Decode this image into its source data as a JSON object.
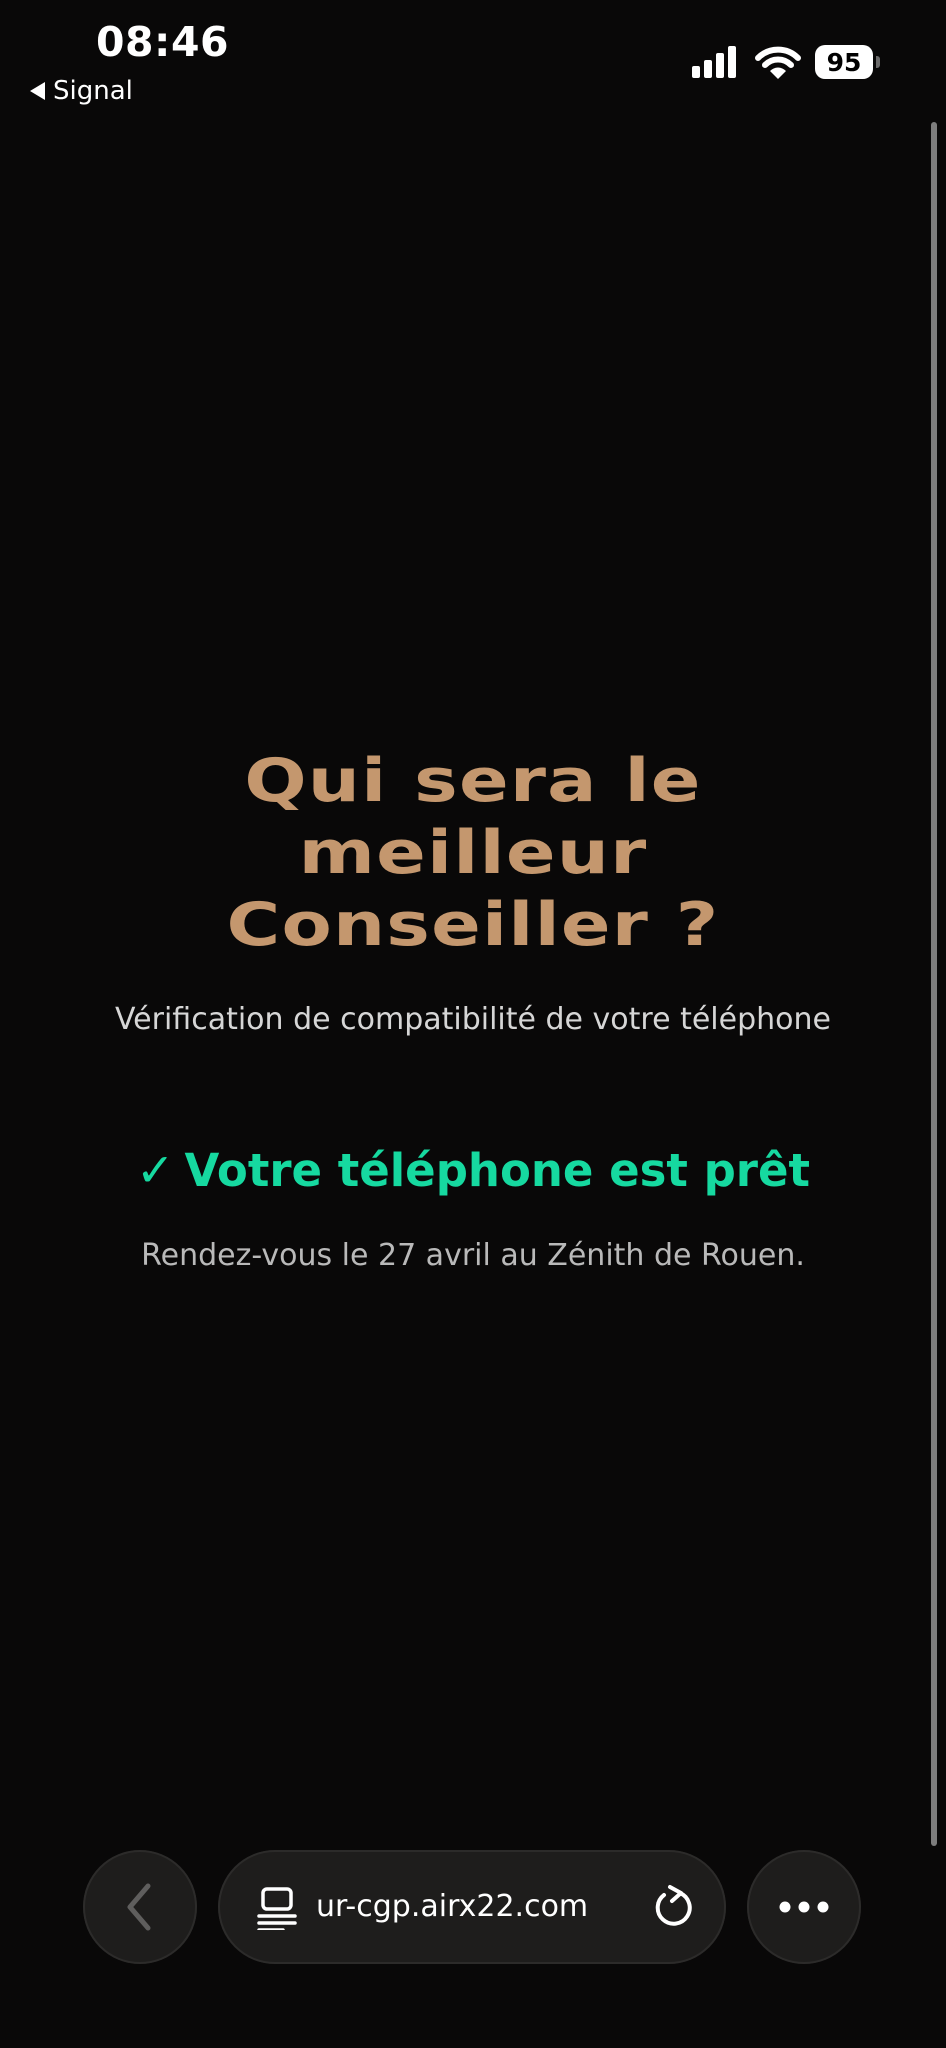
{
  "status_bar": {
    "time": "08:46",
    "back_app_label": "Signal",
    "battery_level": "95",
    "icons": [
      "cellular-signal-icon",
      "wifi-icon",
      "battery-icon"
    ]
  },
  "page": {
    "headline_lines": [
      "Qui sera le",
      "meilleur",
      "Conseiller ?"
    ],
    "subtitle": "Vérification de compatibilité de votre téléphone",
    "ready_check": "✓",
    "ready_text": "Votre téléphone est prêt",
    "event_note": "Rendez-vous le 27 avril au Zénith de Rouen."
  },
  "browser_toolbar": {
    "url": "ur-cgp.airx22.com",
    "icons": [
      "chevron-left-icon",
      "reader-mode-icon",
      "reload-icon",
      "more-icon"
    ]
  },
  "colors": {
    "background": "#090808",
    "headline": "#c4976e",
    "success": "#16d9a0",
    "text": "#d6d6d6"
  }
}
